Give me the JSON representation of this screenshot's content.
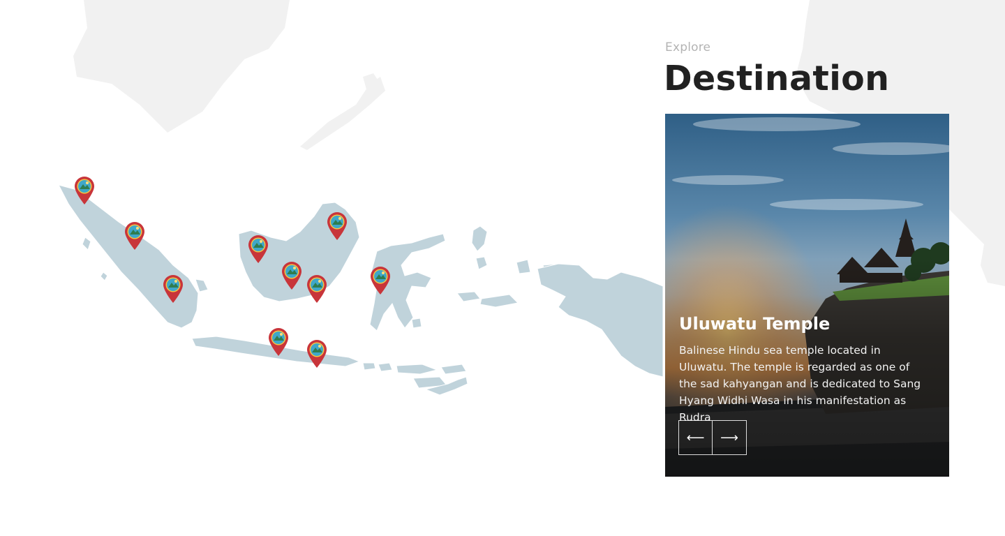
{
  "header": {
    "eyebrow": "Explore",
    "title": "Destination"
  },
  "map": {
    "land_color": "#c0d3db",
    "background_land_color": "#f1f1f1",
    "pin_color": "#c8353a",
    "pin_icon": "landscape-icon",
    "pin_count": 10
  },
  "destination_card": {
    "title": "Uluwatu Temple",
    "description": "Balinese Hindu sea temple located in Uluwatu. The temple is regarded as one of the sad kahyangan and is dedicated to Sang Hyang Widhi Wasa in his manifestation as Rudra",
    "prev_label": "⟵",
    "next_label": "⟶"
  }
}
